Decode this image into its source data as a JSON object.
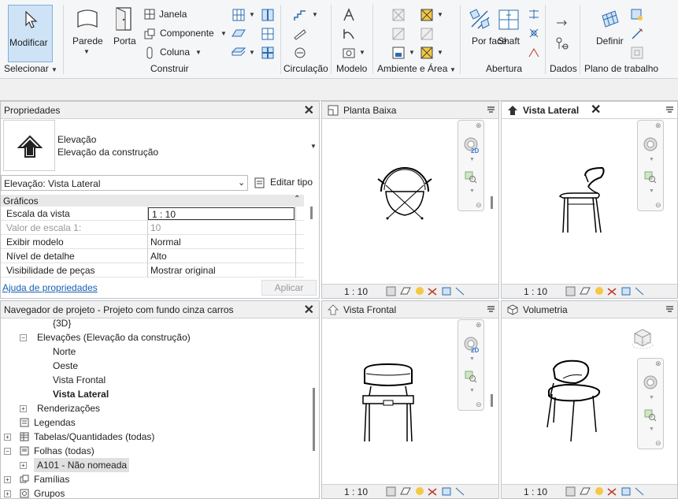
{
  "ribbon": {
    "modify": "Modificar",
    "wall": "Parede",
    "door": "Porta",
    "window": "Janela",
    "component": "Componente",
    "column": "Coluna",
    "by_face": "Por face",
    "shaft": "Shaft",
    "set": "Definir",
    "groups": {
      "select": "Selecionar",
      "build": "Construir",
      "circulation": "Circulação",
      "model": "Modelo",
      "room_area": "Ambiente e Área",
      "opening": "Abertura",
      "datum": "Dados",
      "work_plane": "Plano de trabalho"
    }
  },
  "properties": {
    "title": "Propriedades",
    "type_line1": "Elevação",
    "type_line2": "Elevação da construção",
    "selector": "Elevação: Vista Lateral",
    "edit_type": "Editar tipo",
    "section": "Gráficos",
    "rows": [
      {
        "k": "Escala da vista",
        "v": "1 : 10"
      },
      {
        "k": "Valor de escala    1:",
        "v": "10"
      },
      {
        "k": "Exibir modelo",
        "v": "Normal"
      },
      {
        "k": "Nível de detalhe",
        "v": "Alto"
      },
      {
        "k": "Visibilidade de peças",
        "v": "Mostrar original"
      }
    ],
    "help": "Ajuda de propriedades",
    "apply": "Aplicar"
  },
  "browser": {
    "title": "Navegador de projeto - Projeto com fundo cinza carros",
    "items": [
      "{3D}",
      "Elevações (Elevação da construção)",
      "Norte",
      "Oeste",
      "Vista Frontal",
      "Vista Lateral",
      "Renderizações",
      "Legendas",
      "Tabelas/Quantidades (todas)",
      "Folhas (todas)",
      "A101 - Não nomeada",
      "Famílias",
      "Grupos"
    ]
  },
  "views": {
    "plan": {
      "title": "Planta Baixa",
      "scale": "1 : 10"
    },
    "side": {
      "title": "Vista Lateral",
      "scale": "1 : 10"
    },
    "front": {
      "title": "Vista Frontal",
      "scale": "1 : 10"
    },
    "iso": {
      "title": "Volumetria",
      "scale": "1 : 10"
    },
    "nav_2d": "2D"
  }
}
